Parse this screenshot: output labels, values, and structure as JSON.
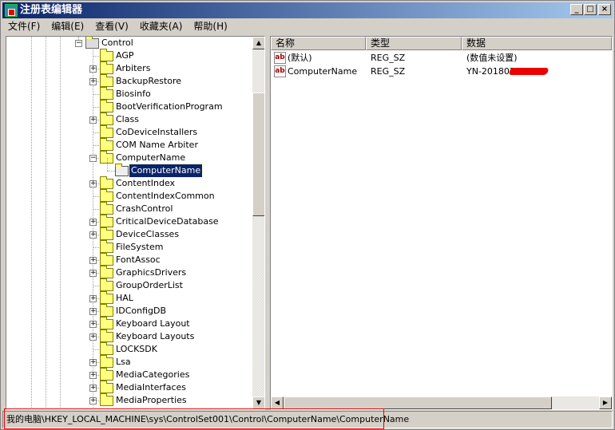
{
  "window": {
    "title": "注册表编辑器",
    "minimize": "_",
    "maximize": "□",
    "close": "×"
  },
  "menu": [
    "文件(F)",
    "编辑(E)",
    "查看(V)",
    "收藏夹(A)",
    "帮助(H)"
  ],
  "tree": {
    "parent": {
      "label": "Control",
      "expanded": true
    },
    "children": [
      {
        "label": "AGP",
        "expandable": false
      },
      {
        "label": "Arbiters",
        "expandable": true
      },
      {
        "label": "BackupRestore",
        "expandable": true
      },
      {
        "label": "Biosinfo",
        "expandable": false
      },
      {
        "label": "BootVerificationProgram",
        "expandable": false
      },
      {
        "label": "Class",
        "expandable": true
      },
      {
        "label": "CoDeviceInstallers",
        "expandable": false
      },
      {
        "label": "COM Name Arbiter",
        "expandable": false
      },
      {
        "label": "ComputerName",
        "expandable": true,
        "expanded": true
      },
      {
        "label": "ComputerName",
        "child": true,
        "selected": true
      },
      {
        "label": "ContentIndex",
        "expandable": true
      },
      {
        "label": "ContentIndexCommon",
        "expandable": false
      },
      {
        "label": "CrashControl",
        "expandable": false
      },
      {
        "label": "CriticalDeviceDatabase",
        "expandable": true
      },
      {
        "label": "DeviceClasses",
        "expandable": true
      },
      {
        "label": "FileSystem",
        "expandable": false
      },
      {
        "label": "FontAssoc",
        "expandable": true
      },
      {
        "label": "GraphicsDrivers",
        "expandable": true
      },
      {
        "label": "GroupOrderList",
        "expandable": false
      },
      {
        "label": "HAL",
        "expandable": true
      },
      {
        "label": "IDConfigDB",
        "expandable": true
      },
      {
        "label": "Keyboard Layout",
        "expandable": true
      },
      {
        "label": "Keyboard Layouts",
        "expandable": true
      },
      {
        "label": "LOCKSDK",
        "expandable": false
      },
      {
        "label": "Lsa",
        "expandable": true
      },
      {
        "label": "MediaCategories",
        "expandable": true
      },
      {
        "label": "MediaInterfaces",
        "expandable": true
      },
      {
        "label": "MediaProperties",
        "expandable": true
      }
    ]
  },
  "list": {
    "columns": [
      "名称",
      "类型",
      "数据"
    ],
    "rows": [
      {
        "name": "(默认)",
        "type": "REG_SZ",
        "data": "(数值未设置)",
        "icon": "string-value-icon"
      },
      {
        "name": "ComputerName",
        "type": "REG_SZ",
        "data": "YN-201802",
        "redacted": true,
        "icon": "string-value-icon"
      }
    ]
  },
  "status": {
    "path": "我的电脑\\HKEY_LOCAL_MACHINE\\sys\\ControlSet001\\Control\\ComputerName\\ComputerName"
  },
  "colors": {
    "title_start": "#0a246a",
    "selection": "#0a246a",
    "highlight_box": "#ee0000",
    "redaction": "#ee0000"
  }
}
